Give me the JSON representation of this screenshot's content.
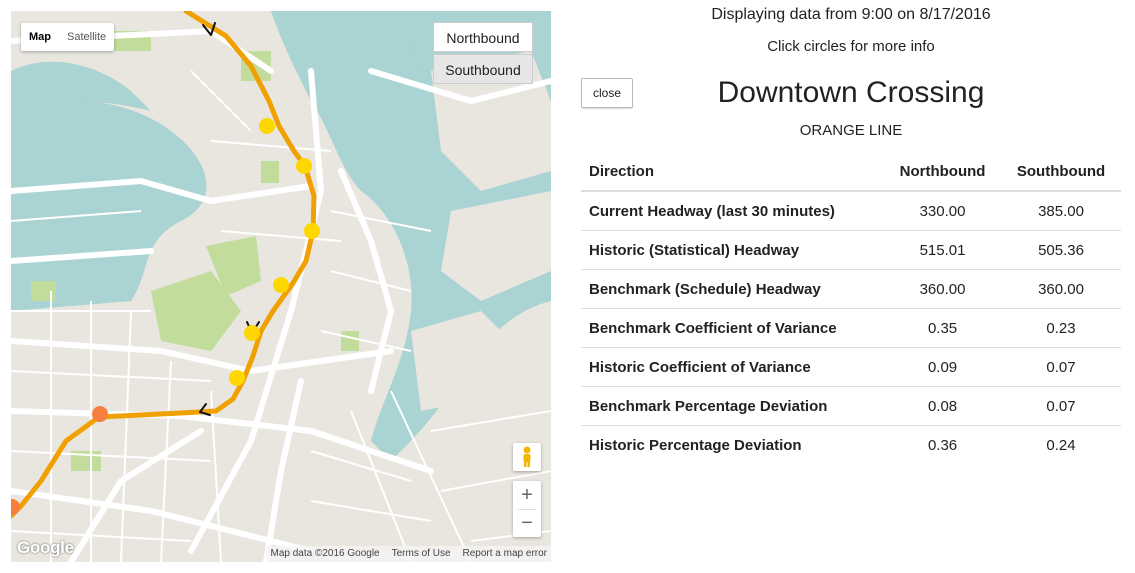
{
  "map": {
    "type_control": {
      "map_label": "Map",
      "satellite_label": "Satellite",
      "active": "Map"
    },
    "direction_buttons": {
      "north_label": "Northbound",
      "south_label": "Southbound",
      "selected": "Southbound"
    },
    "zoom": {
      "in_label": "+",
      "out_label": "−"
    },
    "logo": "Google",
    "attribution": {
      "data": "Map data ©2016 Google",
      "terms": "Terms of Use",
      "report": "Report a map error"
    },
    "line_color": "#f0a000",
    "stop_color_normal": "#ffd700",
    "stop_color_alert": "#f5803e",
    "water_color": "#aad3d3",
    "park_color": "#c2dc9b",
    "arrow_icons": [
      "arrow-down-icon",
      "arrow-down-icon",
      "arrow-down-icon"
    ]
  },
  "panel": {
    "header": "Displaying data from 9:00 on 8/17/2016",
    "hint": "Click circles for more info",
    "close_label": "close",
    "station": "Downtown Crossing",
    "line": "ORANGE LINE",
    "columns": [
      "Direction",
      "Northbound",
      "Southbound"
    ],
    "rows": [
      {
        "label": "Current Headway (last 30 minutes)",
        "north": "330.00",
        "south": "385.00"
      },
      {
        "label": "Historic (Statistical) Headway",
        "north": "515.01",
        "south": "505.36"
      },
      {
        "label": "Benchmark (Schedule) Headway",
        "north": "360.00",
        "south": "360.00"
      },
      {
        "label": "Benchmark Coefficient of Variance",
        "north": "0.35",
        "south": "0.23"
      },
      {
        "label": "Historic Coefficient of Variance",
        "north": "0.09",
        "south": "0.07"
      },
      {
        "label": "Benchmark Percentage Deviation",
        "north": "0.08",
        "south": "0.07"
      },
      {
        "label": "Historic Percentage Deviation",
        "north": "0.36",
        "south": "0.24"
      }
    ]
  }
}
